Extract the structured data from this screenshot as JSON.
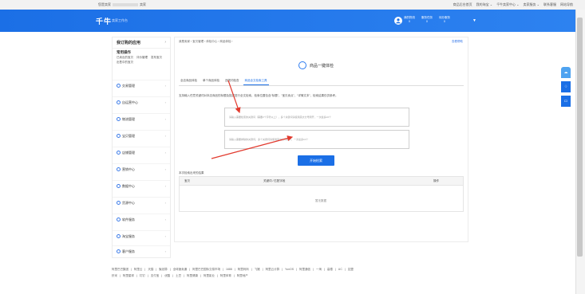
{
  "topbar": {
    "left_text": "您是卖家",
    "left_suffix": "卖家",
    "right_links": [
      "商品后台首页",
      "我的淘宝 ⌄",
      "千牛卖家中心 ⌄",
      "卖家服务 ⌄",
      "联系客服",
      "网站导航"
    ]
  },
  "header": {
    "logo": "千牛",
    "subtitle": "卖家工作台",
    "stats": [
      {
        "label": "我的物流",
        "value": "0"
      },
      {
        "label": "服务任务",
        "value": "0"
      },
      {
        "label": "待办服务",
        "value": "0"
      }
    ]
  },
  "sidebar": {
    "title": "我订购的应用",
    "common_title": "常用操作",
    "common_links": [
      "已卖出的宝贝",
      "评价管理",
      "发布宝贝",
      "出售中的宝贝"
    ],
    "items": [
      "交易管理",
      "自运营中心",
      "物流管理",
      "宝贝管理",
      "店铺管理",
      "营销中心",
      "数据中心",
      "货源中心",
      "软件服务",
      "淘宝服务",
      "客户服务"
    ]
  },
  "content": {
    "breadcrumb": "我是卖家 › 宝贝管理 › 体检中心 › 商品体检 ›",
    "breadcrumb_link": "查看帮助",
    "title": "商品一键体检",
    "tabs": [
      "全店商品体检",
      "单个商品体检",
      "违规词检查",
      "商品全文检索工具"
    ],
    "active_tab": 3,
    "description": "支持输入任意关键词对本店商品的标题及描述进行全文检索，检索位置包含“标题”、“宝贝卖点”、“详情文本”，检索结果仅供参考。",
    "keyword_placeholder": "请输入需要检索的关键词（需要2个字符以上），多个关键词请使用英文分号隔开，一次最多10个",
    "exclude_placeholder": "请输入需要排除的关键词，多个关键词请使用英文分号隔开，一次最多10个",
    "button": "开始检索",
    "result_label": "本次检索出来的结果",
    "table_headers": [
      "宝贝",
      "关键词 / 匹配字段",
      "操作"
    ],
    "empty_text": "暂无数据"
  },
  "footer": {
    "row1": [
      "阿里巴巴集团",
      "阿里云",
      "天猫",
      "聚划算",
      "全球速卖通",
      "阿里巴巴国际交易市场",
      "1688",
      "阿里妈妈",
      "飞猪",
      "阿里云计算",
      "YunOS",
      "阿里通信",
      "一淘",
      "高德",
      "UC",
      "友盟"
    ],
    "row2": [
      "虾米",
      "阿里星球",
      "钉钉",
      "支付宝",
      "优酷",
      "土豆",
      "阿里健康",
      "阿里影业",
      "阿里体育",
      "阿里地产"
    ]
  }
}
